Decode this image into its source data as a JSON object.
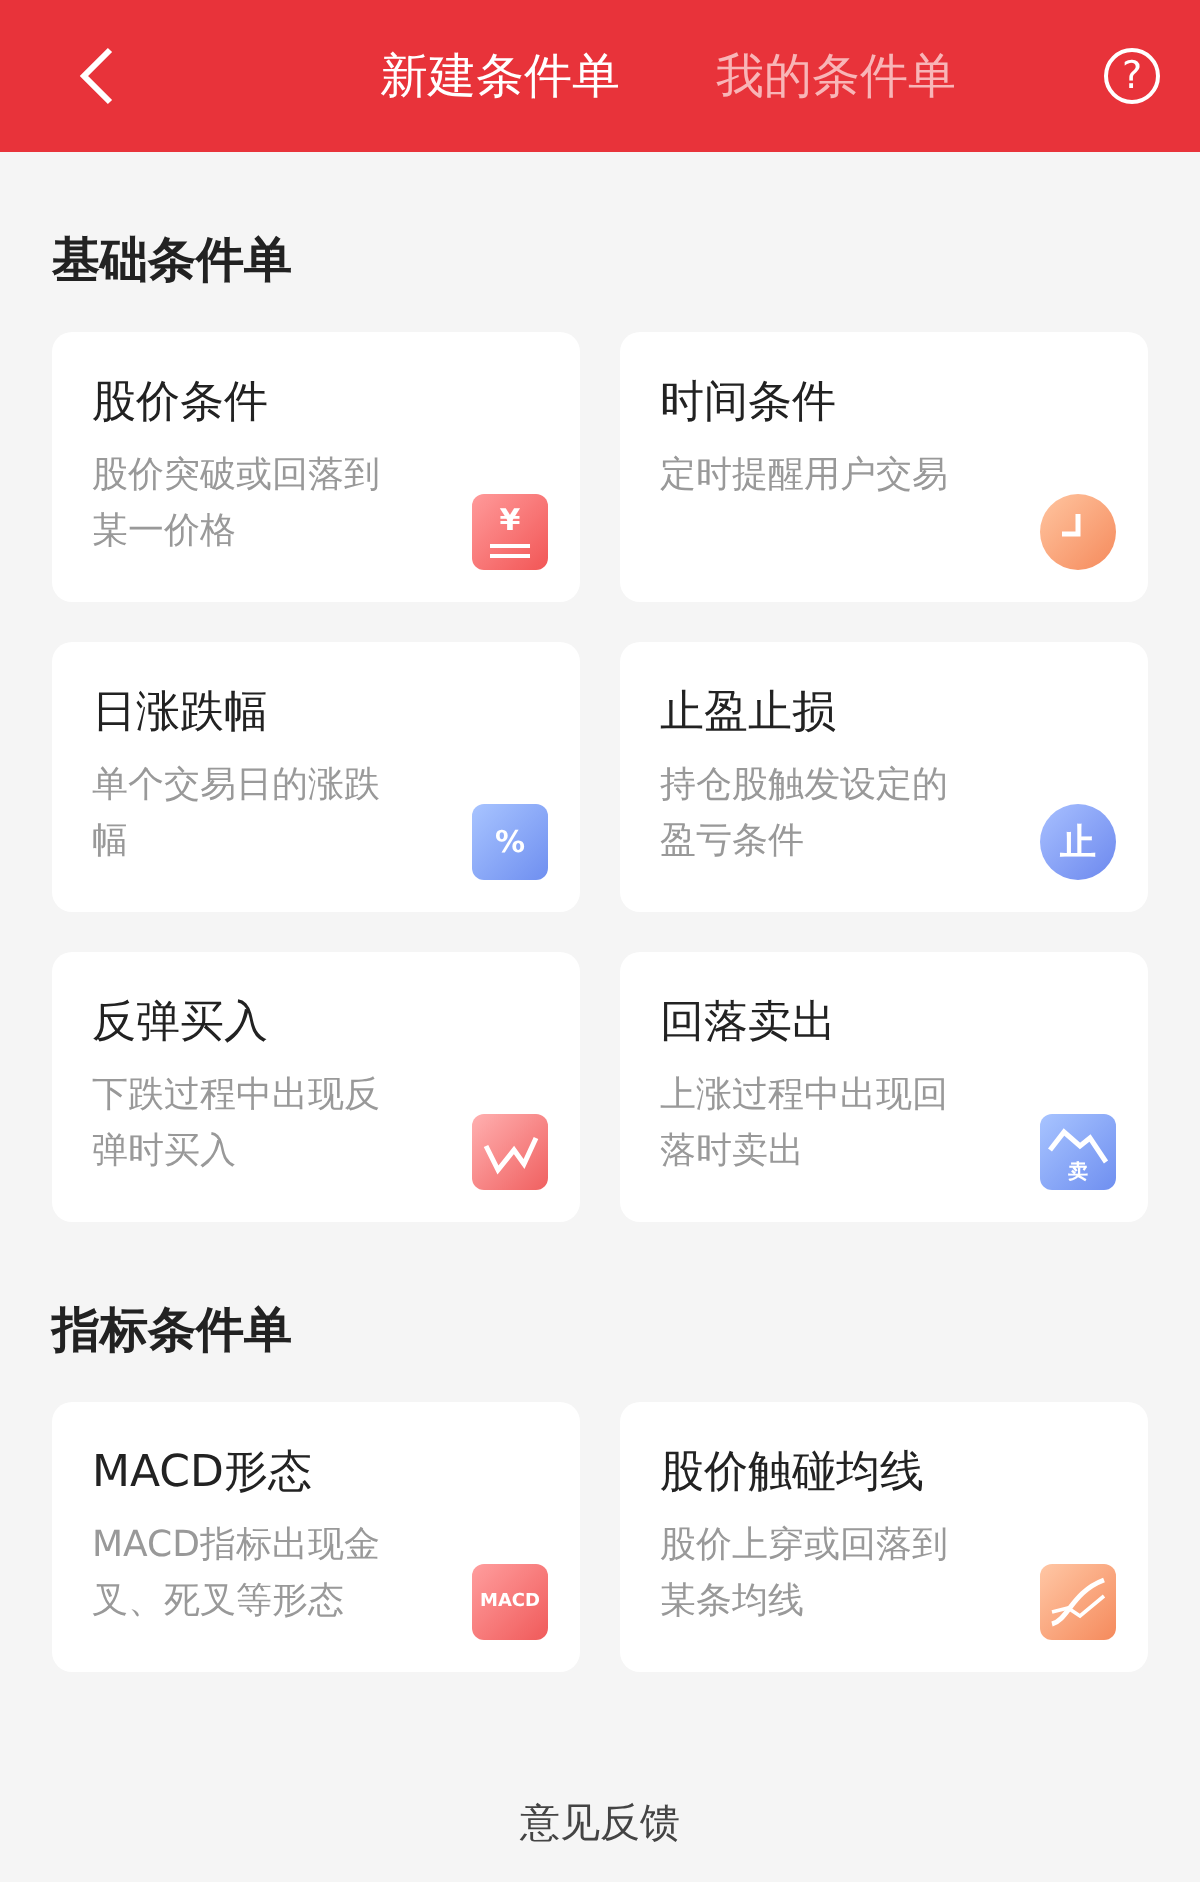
{
  "header": {
    "tabs": [
      {
        "label": "新建条件单",
        "selected": true
      },
      {
        "label": "我的条件单",
        "selected": false
      }
    ],
    "help_label": "?"
  },
  "sections": [
    {
      "title": "基础条件单",
      "cards": [
        {
          "title": "股价条件",
          "description": "股价突破或回落到某一价格",
          "kind": "price",
          "icon_text": "¥"
        },
        {
          "title": "时间条件",
          "description": "定时提醒用户交易",
          "kind": "clock"
        },
        {
          "title": "日涨跌幅",
          "description": "单个交易日的涨跌幅",
          "kind": "calendar",
          "icon_text": "%"
        },
        {
          "title": "止盈止损",
          "description": "持仓股触发设定的盈亏条件",
          "kind": "badge",
          "icon_text": "止"
        },
        {
          "title": "反弹买入",
          "description": "下跌过程中出现反弹时买入",
          "kind": "rise"
        },
        {
          "title": "回落卖出",
          "description": "上涨过程中出现回落时卖出",
          "kind": "fall",
          "icon_text": "卖"
        }
      ]
    },
    {
      "title": "指标条件单",
      "cards": [
        {
          "title": "MACD形态",
          "description": "MACD指标出现金叉、死叉等形态",
          "kind": "macd",
          "icon_text": "MACD"
        },
        {
          "title": "股价触碰均线",
          "description": "股价上穿或回落到某条均线",
          "kind": "ma"
        }
      ]
    }
  ],
  "footer": {
    "feedback": "意见反馈"
  }
}
